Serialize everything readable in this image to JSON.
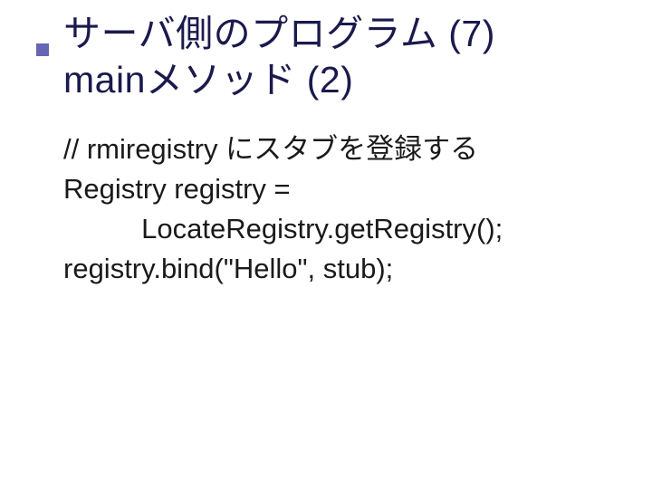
{
  "title": {
    "line1": "サーバ側のプログラム (7)",
    "line2": "mainメソッド (2)"
  },
  "code": {
    "line1": "// rmiregistry にスタブを登録する",
    "line2": "Registry registry =",
    "line3_indent": "          ",
    "line3": "LocateRegistry.getRegistry();",
    "line4": "registry.bind(\"Hello\", stub);"
  }
}
